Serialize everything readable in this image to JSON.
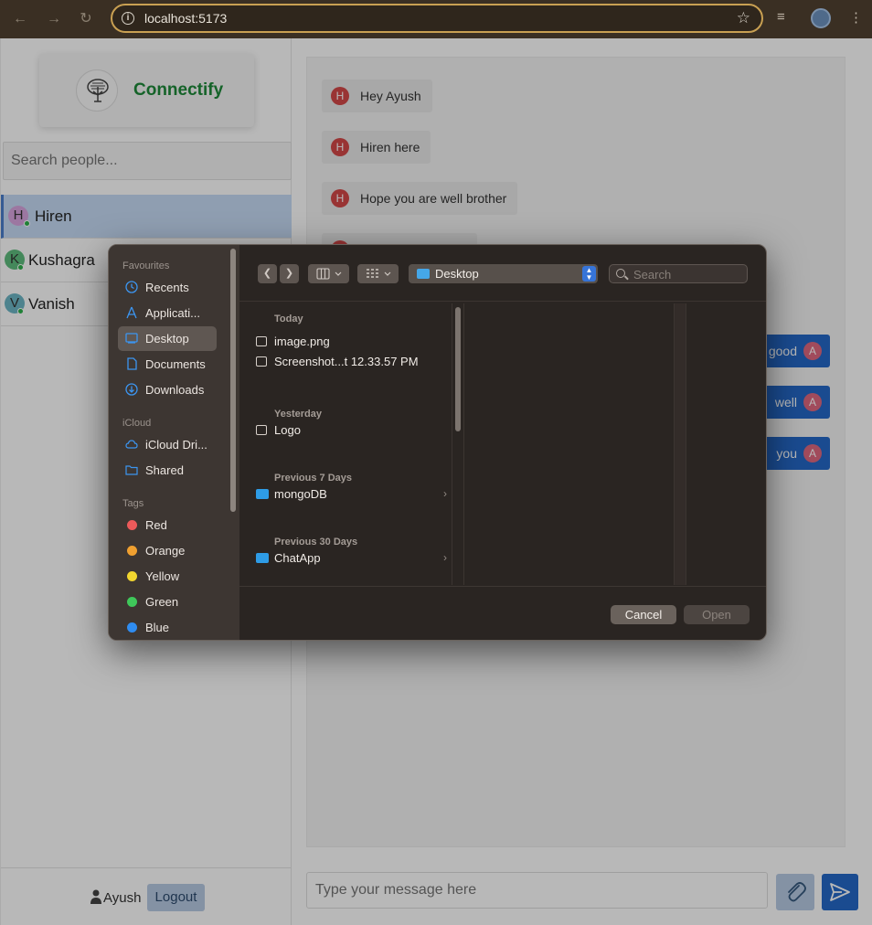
{
  "browser": {
    "url": "localhost:5173"
  },
  "app": {
    "name": "Connectify",
    "search_placeholder": "Search people...",
    "users": [
      {
        "initial": "H",
        "name": "Hiren",
        "color": "#d9a6e0",
        "active": true
      },
      {
        "initial": "K",
        "name": "Kushagra",
        "color": "#5fbd7f",
        "active": false
      },
      {
        "initial": "V",
        "name": "Vanish",
        "color": "#6cb6c5",
        "active": false
      }
    ],
    "current_user": "Ayush",
    "logout_label": "Logout",
    "messages_in": [
      {
        "avatar": "H",
        "text": "Hey Ayush"
      },
      {
        "avatar": "H",
        "text": "Hiren here"
      },
      {
        "avatar": "H",
        "text": "Hope you are well brother"
      }
    ],
    "messages_out_visible": [
      {
        "text": "good",
        "avatar": "A"
      },
      {
        "text": "well",
        "avatar": "A"
      },
      {
        "text": "you",
        "avatar": "A"
      }
    ],
    "message_placeholder": "Type your message here"
  },
  "dialog": {
    "sidebar": {
      "favourites_label": "Favourites",
      "favourites": [
        "Recents",
        "Applicati...",
        "Desktop",
        "Documents",
        "Downloads"
      ],
      "icloud_label": "iCloud",
      "icloud": [
        "iCloud Dri...",
        "Shared"
      ],
      "tags_label": "Tags",
      "tags": [
        {
          "name": "Red",
          "color": "#ec5a5a"
        },
        {
          "name": "Orange",
          "color": "#f0a030"
        },
        {
          "name": "Yellow",
          "color": "#f2d62f"
        },
        {
          "name": "Green",
          "color": "#3fc85a"
        },
        {
          "name": "Blue",
          "color": "#2f8cf0"
        }
      ]
    },
    "location": "Desktop",
    "search_placeholder": "Search",
    "groups": {
      "today": "Today",
      "yesterday": "Yesterday",
      "prev7": "Previous 7 Days",
      "prev30": "Previous 30 Days"
    },
    "files": {
      "image": "image.png",
      "screenshot": "Screenshot...t 12.33.57 PM",
      "logo": "Logo",
      "mongodb": "mongoDB",
      "chatapp": "ChatApp"
    },
    "cancel_label": "Cancel",
    "open_label": "Open"
  }
}
